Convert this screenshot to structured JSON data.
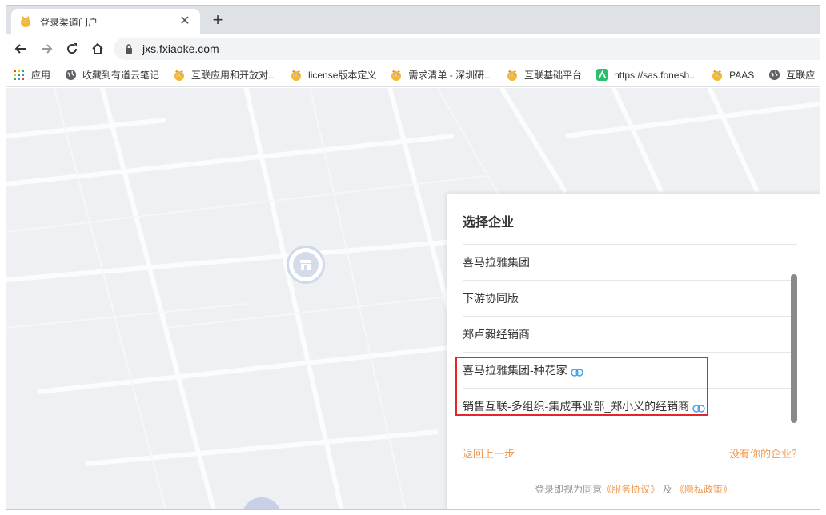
{
  "browser": {
    "tab_title": "登录渠道门户",
    "tab_close": "✕",
    "new_tab": "+",
    "url": "jxs.fxiaoke.com"
  },
  "bookmarks": [
    {
      "label": "应用",
      "icon": "apps-grid-icon"
    },
    {
      "label": "收藏到有道云笔记",
      "icon": "globe-icon"
    },
    {
      "label": "互联应用和开放对...",
      "icon": "fxiaoke-icon"
    },
    {
      "label": "license版本定义",
      "icon": "fxiaoke-icon"
    },
    {
      "label": "需求清单 - 深圳研...",
      "icon": "fxiaoke-icon"
    },
    {
      "label": "互联基础平台",
      "icon": "fxiaoke-icon"
    },
    {
      "label": "https://sas.fonesh...",
      "icon": "green-app-icon"
    },
    {
      "label": "PAAS",
      "icon": "fxiaoke-icon"
    },
    {
      "label": "互联应",
      "icon": "globe-icon"
    }
  ],
  "panel": {
    "title": "选择企业",
    "companies": [
      {
        "name": "喜马拉雅集团",
        "linked": false
      },
      {
        "name": "下游协同版",
        "linked": false
      },
      {
        "name": "郑卢毅经销商",
        "linked": false
      },
      {
        "name": "喜马拉雅集团-种花家",
        "linked": true
      },
      {
        "name": "销售互联-多组织-集成事业部_郑小义的经销商",
        "linked": true
      }
    ],
    "back": "返回上一步",
    "no_company": "没有你的企业？",
    "agreement_prefix": "登录即视为同意",
    "service_agreement": "《服务协议》",
    "agreement_and": "及",
    "privacy_policy": "《隐私政策》"
  },
  "colors": {
    "accent_orange": "#f09a51",
    "highlight_red": "#e8242b",
    "link_blue": "#3fa0e6"
  }
}
